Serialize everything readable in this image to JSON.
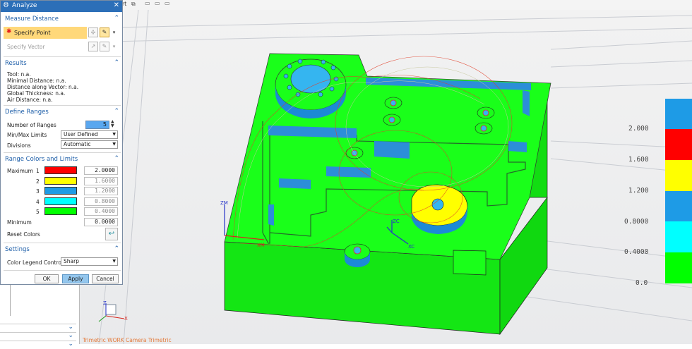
{
  "top_tab_fragment": "ort",
  "dialog": {
    "title": "Analyze",
    "measure_distance": {
      "header": "Measure Distance",
      "specify_point": "Specify Point",
      "specify_vector": "Specify Vector"
    },
    "results": {
      "header": "Results",
      "lines": [
        "Tool: n.a.",
        "Minimal Distance: n.a.",
        "Distance along Vector: n.a.",
        "Global Thickness: n.a.",
        "Air Distance: n.a."
      ]
    },
    "define_ranges": {
      "header": "Define Ranges",
      "number_of_ranges_label": "Number of Ranges",
      "number_of_ranges_value": "5",
      "minmax_label": "Min/Max Limits",
      "minmax_value": "User Defined",
      "divisions_label": "Divisions",
      "divisions_value": "Automatic"
    },
    "range_colors": {
      "header": "Range Colors and Limits",
      "maximum_label": "Maximum",
      "minimum_label": "Minimum",
      "minimum_value": "0.0000",
      "reset_label": "Reset Colors",
      "rows": [
        {
          "index": "1",
          "color": "#ff0000",
          "value": "2.0000"
        },
        {
          "index": "2",
          "color": "#ffff00",
          "value": "1.6000"
        },
        {
          "index": "3",
          "color": "#1e9be6",
          "value": "1.2000"
        },
        {
          "index": "4",
          "color": "#00ffff",
          "value": "0.8000"
        },
        {
          "index": "5",
          "color": "#00ff00",
          "value": "0.4000"
        }
      ]
    },
    "settings": {
      "header": "Settings",
      "legend_label": "Color Legend Control",
      "legend_value": "Sharp"
    },
    "buttons": {
      "ok": "OK",
      "apply": "Apply",
      "cancel": "Cancel"
    }
  },
  "viewport": {
    "view_label": "Trimetric WORK Camera Trimetric",
    "axes": {
      "zm": "ZM",
      "xm": "XM",
      "zc": "ZC",
      "xc": "XC"
    },
    "mini_axes": {
      "z": "Z",
      "x": "X"
    },
    "legend": {
      "values": [
        "2.000",
        "1.600",
        "1.200",
        "0.8000",
        "0.4000",
        "0.0"
      ],
      "colors": [
        "#1e9be6",
        "#ff0000",
        "#ffff00",
        "#1e9be6",
        "#00ffff",
        "#00ff00"
      ]
    }
  }
}
